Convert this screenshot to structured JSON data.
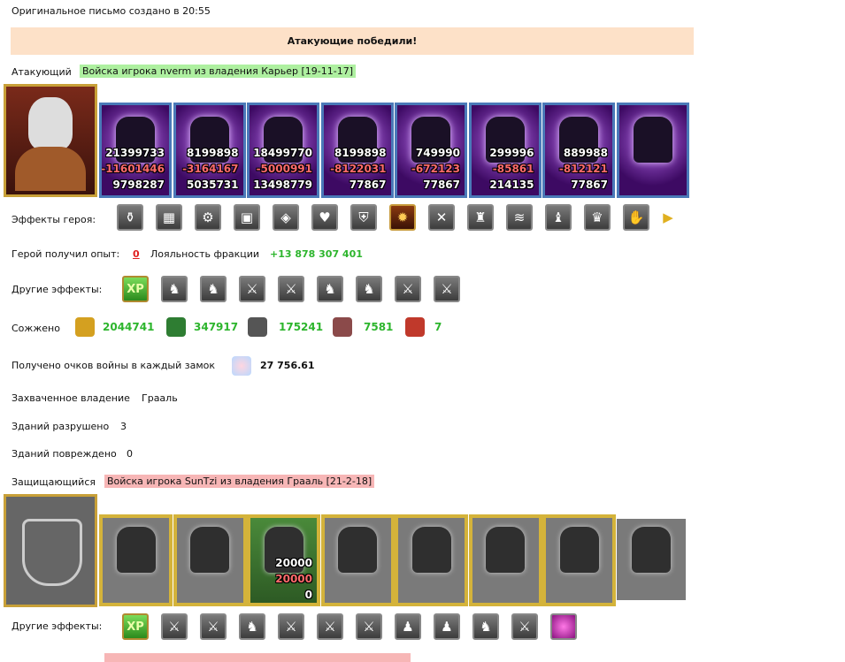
{
  "header": {
    "original_letter": "Оригинальное письмо создано в 20:55",
    "result": "Атакующие победили!"
  },
  "attacker": {
    "label": "Атакующий",
    "army": "Войска игрока nverm из владения Карьер [19-11-17]",
    "units": [
      {
        "n1": "21399733",
        "n2": "-11601446",
        "n3": "9798287"
      },
      {
        "n1": "8199898",
        "n2": "-3164167",
        "n3": "5035731"
      },
      {
        "n1": "18499770",
        "n2": "-5000991",
        "n3": "13498779"
      },
      {
        "n1": "8199898",
        "n2": "-8122031",
        "n3": "77867"
      },
      {
        "n1": "749990",
        "n2": "-672123",
        "n3": "77867"
      },
      {
        "n1": "299996",
        "n2": "-85861",
        "n3": "214135"
      },
      {
        "n1": "889988",
        "n2": "-812121",
        "n3": "77867"
      },
      {
        "n1": "",
        "n2": "",
        "n3": ""
      }
    ],
    "hero_effects_label": "Эффекты героя:",
    "hero_effects": [
      "cauldron-icon",
      "armor-grid-icon",
      "gear-box-icon",
      "chest-icon",
      "treasure-icon",
      "heart-icon",
      "shield-icon",
      "fire-rune-icon",
      "crossed-swords-icon",
      "mage-icon",
      "scroll-icon",
      "boots-icon",
      "dragon-icon",
      "glove-icon",
      "arrow-right-icon"
    ],
    "exp_label": "Герой получил опыт:",
    "exp_value": "0",
    "loyalty_label": "Лояльность фракции",
    "loyalty_value": "+13 878 307 401",
    "other_effects_label": "Другие эффекты:",
    "other_effects": [
      "XP",
      "horse-icon",
      "horse-icon",
      "sword-icon",
      "sword-icon",
      "horse-icon",
      "horse-icon",
      "sword-icon",
      "sword-icon"
    ],
    "burned_label": "Сожжено",
    "burned": [
      {
        "icon": "gold-icon",
        "value": "2044741"
      },
      {
        "icon": "wood-icon",
        "value": "347917"
      },
      {
        "icon": "ore-icon",
        "value": "175241"
      },
      {
        "icon": "stone-icon",
        "value": "7581"
      },
      {
        "icon": "worker-icon",
        "value": "7"
      }
    ],
    "war_points_label": "Получено очков войны в каждый замок",
    "war_points_value": "27 756.61",
    "captured_label": "Захваченное владение",
    "captured_value": "Грааль",
    "destroyed_label": "Зданий разрушено",
    "destroyed_value": "3",
    "damaged_label": "Зданий повреждено",
    "damaged_value": "0"
  },
  "defender": {
    "label": "Защищающийся",
    "army": "Войска игрока SunTzi из владения Грааль [21-2-18]",
    "units": [
      {
        "n1": "",
        "n2": "",
        "n3": ""
      },
      {
        "n1": "",
        "n2": "",
        "n3": ""
      },
      {
        "n1": "20000",
        "n2": "20000",
        "n3": "0"
      },
      {
        "n1": "",
        "n2": "",
        "n3": ""
      },
      {
        "n1": "",
        "n2": "",
        "n3": ""
      },
      {
        "n1": "",
        "n2": "",
        "n3": ""
      },
      {
        "n1": "",
        "n2": "",
        "n3": ""
      },
      {
        "n1": "",
        "n2": "",
        "n3": ""
      }
    ],
    "other_effects_label": "Другие эффекты:",
    "other_effects": [
      "XP",
      "sword-icon",
      "sword-icon",
      "horse-icon",
      "sword-icon",
      "sword-icon",
      "sword-icon",
      "pawn-icon",
      "pawn-icon",
      "horse-icon",
      "sword-icon",
      "pink-orb-icon"
    ]
  }
}
